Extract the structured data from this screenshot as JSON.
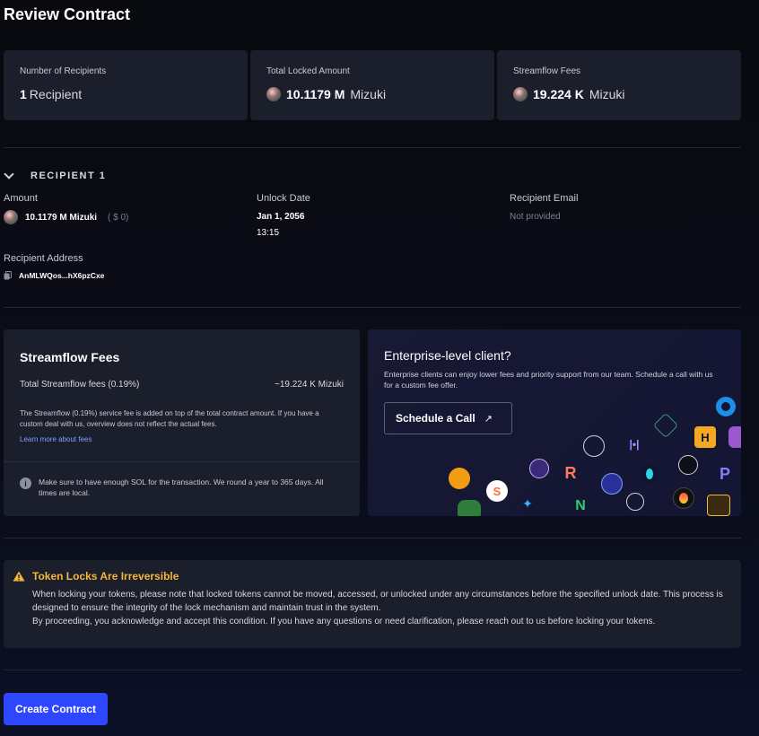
{
  "page": {
    "title": "Review Contract"
  },
  "summary": {
    "recipients_label": "Number of Recipients",
    "recipients_count": "1",
    "recipients_unit": "Recipient",
    "locked_label": "Total Locked Amount",
    "locked_value": "10.1179 M",
    "locked_unit": "Mizuki",
    "fees_label": "Streamflow Fees",
    "fees_value": "19.224 K",
    "fees_unit": "Mizuki"
  },
  "recipient": {
    "heading": "RECIPIENT 1",
    "amount_label": "Amount",
    "amount_value": "10.1179 M Mizuki",
    "amount_usd": "( $ 0)",
    "unlock_label": "Unlock Date",
    "unlock_date": "Jan 1, 2056",
    "unlock_time": "13:15",
    "email_label": "Recipient Email",
    "email_value": "Not provided",
    "address_label": "Recipient Address",
    "address_value": "AnMLWQos...hX6pzCxe"
  },
  "fees_card": {
    "title": "Streamflow Fees",
    "row_label": "Total Streamflow fees (0.19%)",
    "row_value": "~19.224 K Mizuki",
    "description": "The Streamflow (0.19%) service fee is added on top of the total contract amount. If you have a custom deal with us, overview does not reflect the actual fees.",
    "link": "Learn more about fees",
    "note": "Make sure to have enough SOL for the transaction. We round a year to 365 days. All times are local."
  },
  "enterprise": {
    "title": "Enterprise-level client?",
    "description": "Enterprise clients can enjoy lower fees and priority support from our team. Schedule a call with us for a custom fee offer.",
    "button": "Schedule a Call",
    "button_icon": "↗"
  },
  "warning": {
    "title": "Token Locks Are Irreversible",
    "line1": "When locking your tokens, please note that locked tokens cannot be moved, accessed, or unlocked under any circumstances before the specified unlock date. This process is designed to ensure the integrity of the lock mechanism and maintain trust in the system.",
    "line2": "By proceeding, you acknowledge and accept this condition. If you have any questions or need clarification, please reach out to us before locking your tokens."
  },
  "actions": {
    "create": "Create Contract"
  },
  "colors": {
    "accent": "#2f46ff",
    "warning": "#f5b73b",
    "link": "#7da1ff",
    "card": "#1b1e2b"
  },
  "icons": [
    "chevron-down-icon",
    "token-icon",
    "copy-icon",
    "info-icon",
    "warning-icon",
    "arrow-up-right-icon"
  ]
}
